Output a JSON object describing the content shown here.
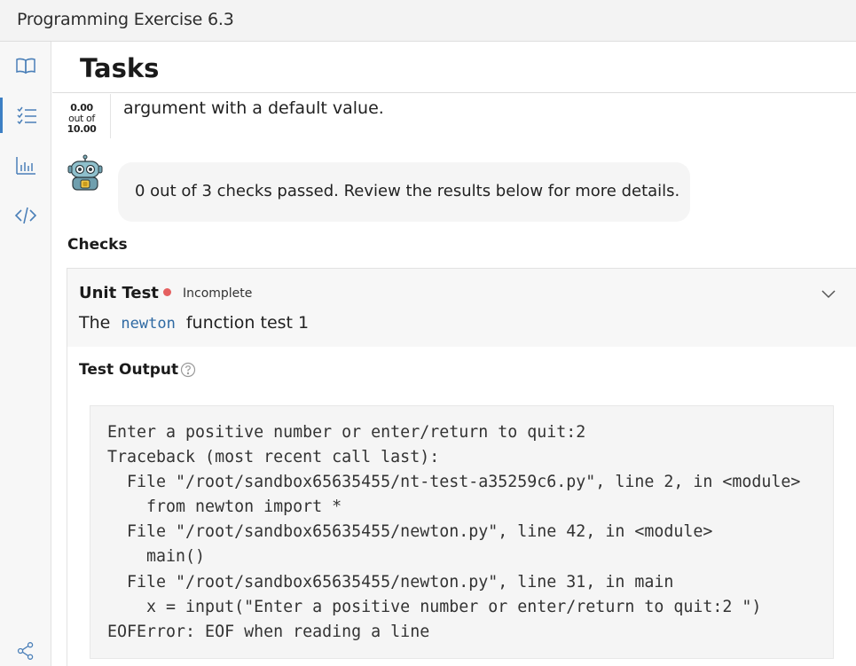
{
  "window": {
    "title": "Programming Exercise 6.3"
  },
  "sidebar": {
    "items": [
      {
        "name": "book",
        "icon": "book-icon"
      },
      {
        "name": "tasks",
        "icon": "checklist-icon",
        "active": true
      },
      {
        "name": "stats",
        "icon": "bar-chart-icon"
      },
      {
        "name": "code",
        "icon": "code-icon"
      }
    ],
    "bottom_icon": "share-icon"
  },
  "header": {
    "title": "Tasks"
  },
  "task": {
    "score": "0.00",
    "score_out_of_label": "out of",
    "score_max": "10.00",
    "text": "argument with a default value."
  },
  "bot": {
    "icon": "robot-avatar",
    "message": "0 out of 3 checks passed. Review the results below for more details."
  },
  "checks": {
    "heading": "Checks",
    "items": [
      {
        "title": "Unit Test",
        "status": "Incomplete",
        "status_color": "#e56060",
        "desc_before": "The",
        "desc_code": "newton",
        "desc_after": "function test 1",
        "output_label": "Test Output",
        "output": "Enter a positive number or enter/return to quit:2\nTraceback (most recent call last):\n  File \"/root/sandbox65635455/nt-test-a35259c6.py\", line 2, in <module>\n    from newton import *\n  File \"/root/sandbox65635455/newton.py\", line 42, in <module>\n    main()\n  File \"/root/sandbox65635455/newton.py\", line 31, in main\n    x = input(\"Enter a positive number or enter/return to quit:2 \")\nEOFError: EOF when reading a line"
      }
    ]
  },
  "colors": {
    "accent": "#3d7fc4",
    "code_blue": "#2f6aa3",
    "sidebar_icon": "#3d7fc4"
  }
}
